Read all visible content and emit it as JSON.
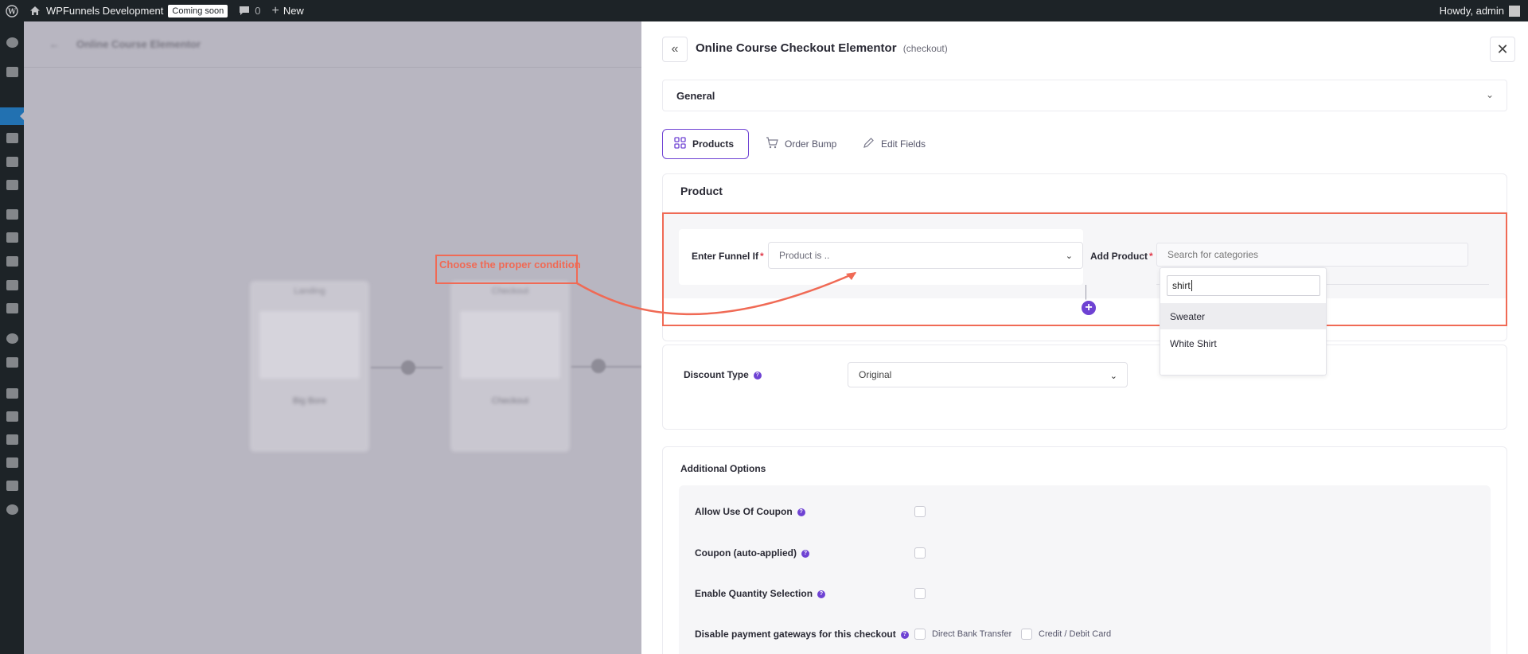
{
  "admin_bar": {
    "site_name": "WPFunnels Development",
    "coming_soon": "Coming soon",
    "comments_count": "0",
    "new_label": "New",
    "greeting": "Howdy, admin"
  },
  "canvas": {
    "funnel_title": "Online Course Elementor",
    "nodes": [
      {
        "label": "Landing",
        "name": "Big Bore"
      },
      {
        "label": "Checkout",
        "name": "Checkout"
      }
    ]
  },
  "annotation": {
    "text": "Choose the proper condition",
    "color": "#f06a55"
  },
  "drawer": {
    "title": "Online Course Checkout Elementor",
    "type": "(checkout)",
    "general_label": "General",
    "tabs": [
      {
        "label": "Products",
        "icon": "grid-icon",
        "active": true
      },
      {
        "label": "Order Bump",
        "icon": "cart-icon",
        "active": false
      },
      {
        "label": "Edit Fields",
        "icon": "pencil-icon",
        "active": false
      }
    ],
    "product_card": {
      "title": "Product",
      "funnel_if_label": "Enter Funnel If",
      "funnel_if_placeholder": "Product is ..",
      "add_product_label": "Add Product",
      "add_product_placeholder": "Search for categories",
      "search_value": "shirt",
      "results": [
        "Sweater",
        "White Shirt"
      ]
    },
    "discount": {
      "label": "Discount Type",
      "value": "Original"
    },
    "additional": {
      "title": "Additional Options",
      "options": [
        {
          "label": "Allow Use Of Coupon"
        },
        {
          "label": "Coupon (auto-applied)"
        },
        {
          "label": "Enable Quantity Selection"
        },
        {
          "label": "Disable payment gateways for this checkout"
        }
      ],
      "gateways": [
        "Direct Bank Transfer",
        "Credit / Debit Card"
      ]
    }
  },
  "colors": {
    "accent": "#6e42d3",
    "admin_bar": "#1d2327",
    "required": "#e0394a"
  }
}
